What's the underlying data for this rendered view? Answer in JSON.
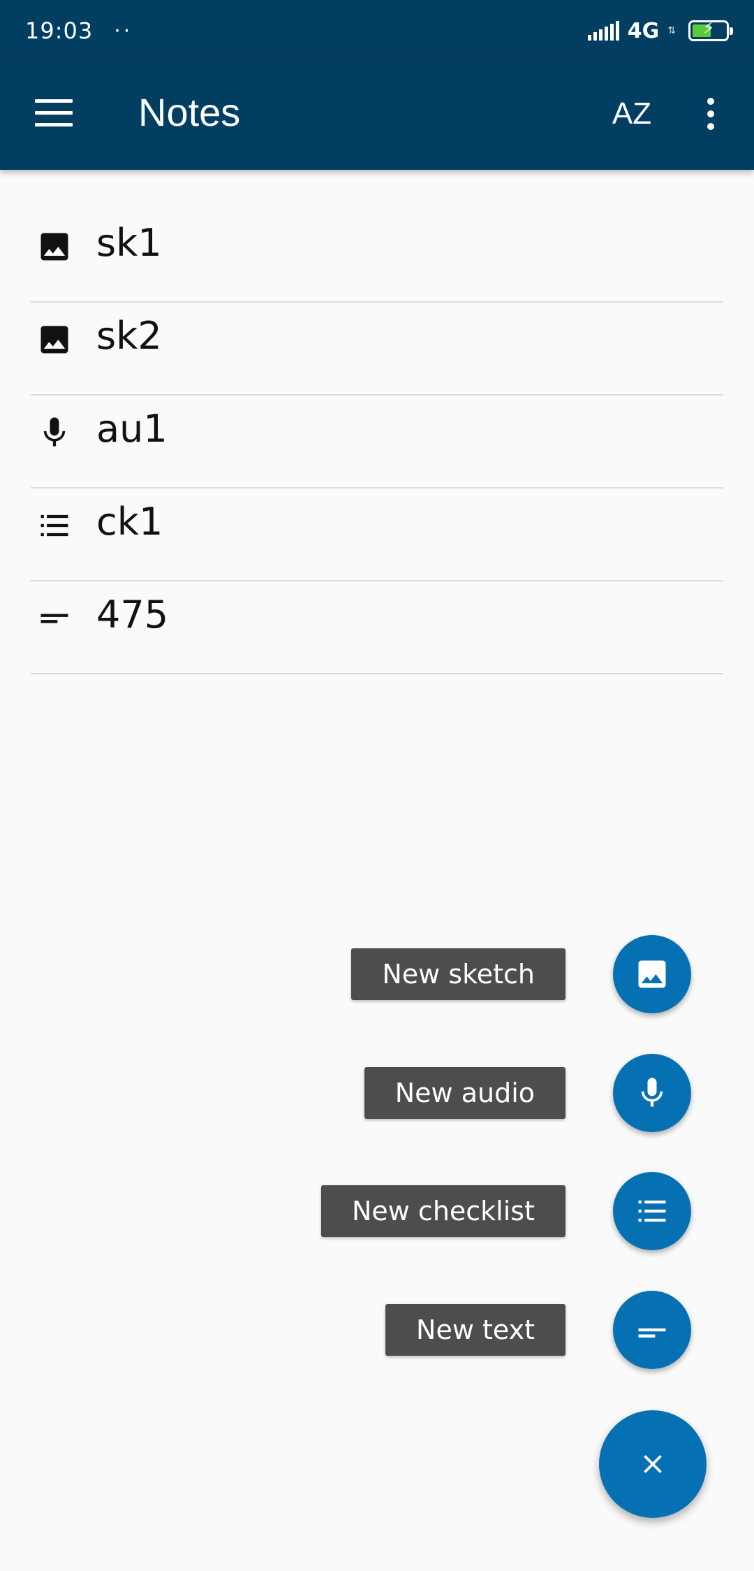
{
  "status_bar": {
    "time": "19:03",
    "dots": "··",
    "network": "4G"
  },
  "app_bar": {
    "title": "Notes",
    "sort_label": "AZ"
  },
  "notes": [
    {
      "title": "sk1",
      "icon": "image-icon"
    },
    {
      "title": "sk2",
      "icon": "image-icon"
    },
    {
      "title": "au1",
      "icon": "microphone-icon"
    },
    {
      "title": "ck1",
      "icon": "checklist-icon"
    },
    {
      "title": "475",
      "icon": "text-icon"
    }
  ],
  "fab_actions": [
    {
      "label": "New sketch",
      "icon": "image-icon"
    },
    {
      "label": "New audio",
      "icon": "microphone-icon"
    },
    {
      "label": "New checklist",
      "icon": "checklist-icon"
    },
    {
      "label": "New text",
      "icon": "text-icon"
    }
  ],
  "fab_main": {
    "icon": "close-icon"
  },
  "colors": {
    "app_bar": "#023e61",
    "accent": "#0571b3",
    "label_bg": "#4d4d4d",
    "background": "#fafafa"
  }
}
